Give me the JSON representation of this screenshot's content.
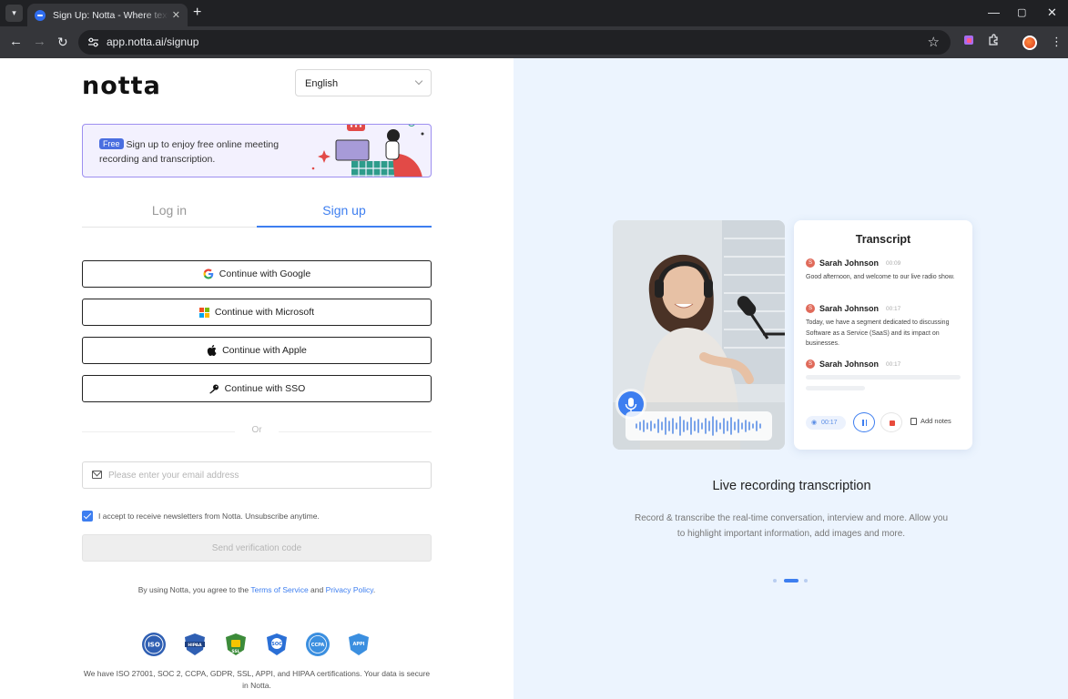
{
  "browser": {
    "tab_title": "Sign Up: Notta - Where text meets",
    "url": "app.notta.ai/signup",
    "icons": [
      "tab-search-icon",
      "tab-close-icon",
      "new-tab-icon",
      "minimize-icon",
      "maximize-icon",
      "close-window-icon",
      "back-icon",
      "forward-icon",
      "reload-icon",
      "site-info-icon",
      "bookmark-star-icon",
      "extension-icon",
      "puzzle-icon",
      "profile-avatar"
    ]
  },
  "header": {
    "logo": "notta",
    "language": "English"
  },
  "banner": {
    "badge": "Free",
    "text": "Sign up to enjoy free online meeting recording and transcription."
  },
  "auth_tabs": {
    "login": "Log in",
    "signup": "Sign up",
    "active": "signup"
  },
  "providers": {
    "google": "Continue with Google",
    "microsoft": "Continue with Microsoft",
    "apple": "Continue with Apple",
    "sso": "Continue with SSO"
  },
  "divider": "Or",
  "email": {
    "placeholder": "Please enter your email address",
    "value": ""
  },
  "newsletter": {
    "checked": true,
    "label": "I accept to receive newsletters from Notta. Unsubscribe anytime."
  },
  "send_button": "Send verification code",
  "terms": {
    "prefix": "By using Notta, you agree to the",
    "terms_link": "Terms of Service",
    "and": "and",
    "privacy_link": "Privacy Policy",
    "suffix": "."
  },
  "certifications": {
    "badges": [
      "ISO",
      "HIPAA",
      "SSL",
      "SOC",
      "CCPA",
      "APPI"
    ],
    "text": "We have ISO 27001, SOC 2, CCPA, GDPR, SSL, APPI, and HIPAA certifications.  Your data is secure in Notta."
  },
  "showcase": {
    "transcript_title": "Transcript",
    "entries": [
      {
        "speaker": "Sarah Johnson",
        "time": "00:09",
        "text": "Good afternoon, and welcome to our live radio show."
      },
      {
        "speaker": "Sarah Johnson",
        "time": "00:17",
        "text": "Today, we have a segment dedicated to discussing Software as a Service (SaaS) and its impact on businesses."
      },
      {
        "speaker": "Sarah Johnson",
        "time": "00:17",
        "text": ""
      }
    ],
    "speaker_initial": "S",
    "timer": "00:17",
    "add_notes": "Add notes",
    "feature_title": "Live recording transcription",
    "feature_desc": "Record & transcribe the real-time conversation, interview and more. Allow you to highlight important information, add images and more.",
    "carousel": {
      "total": 3,
      "active": 2
    }
  },
  "colors": {
    "accent": "#3d7ef0",
    "right_panel_bg": "#ecf4fe",
    "banner_border": "#9d8ff0"
  }
}
